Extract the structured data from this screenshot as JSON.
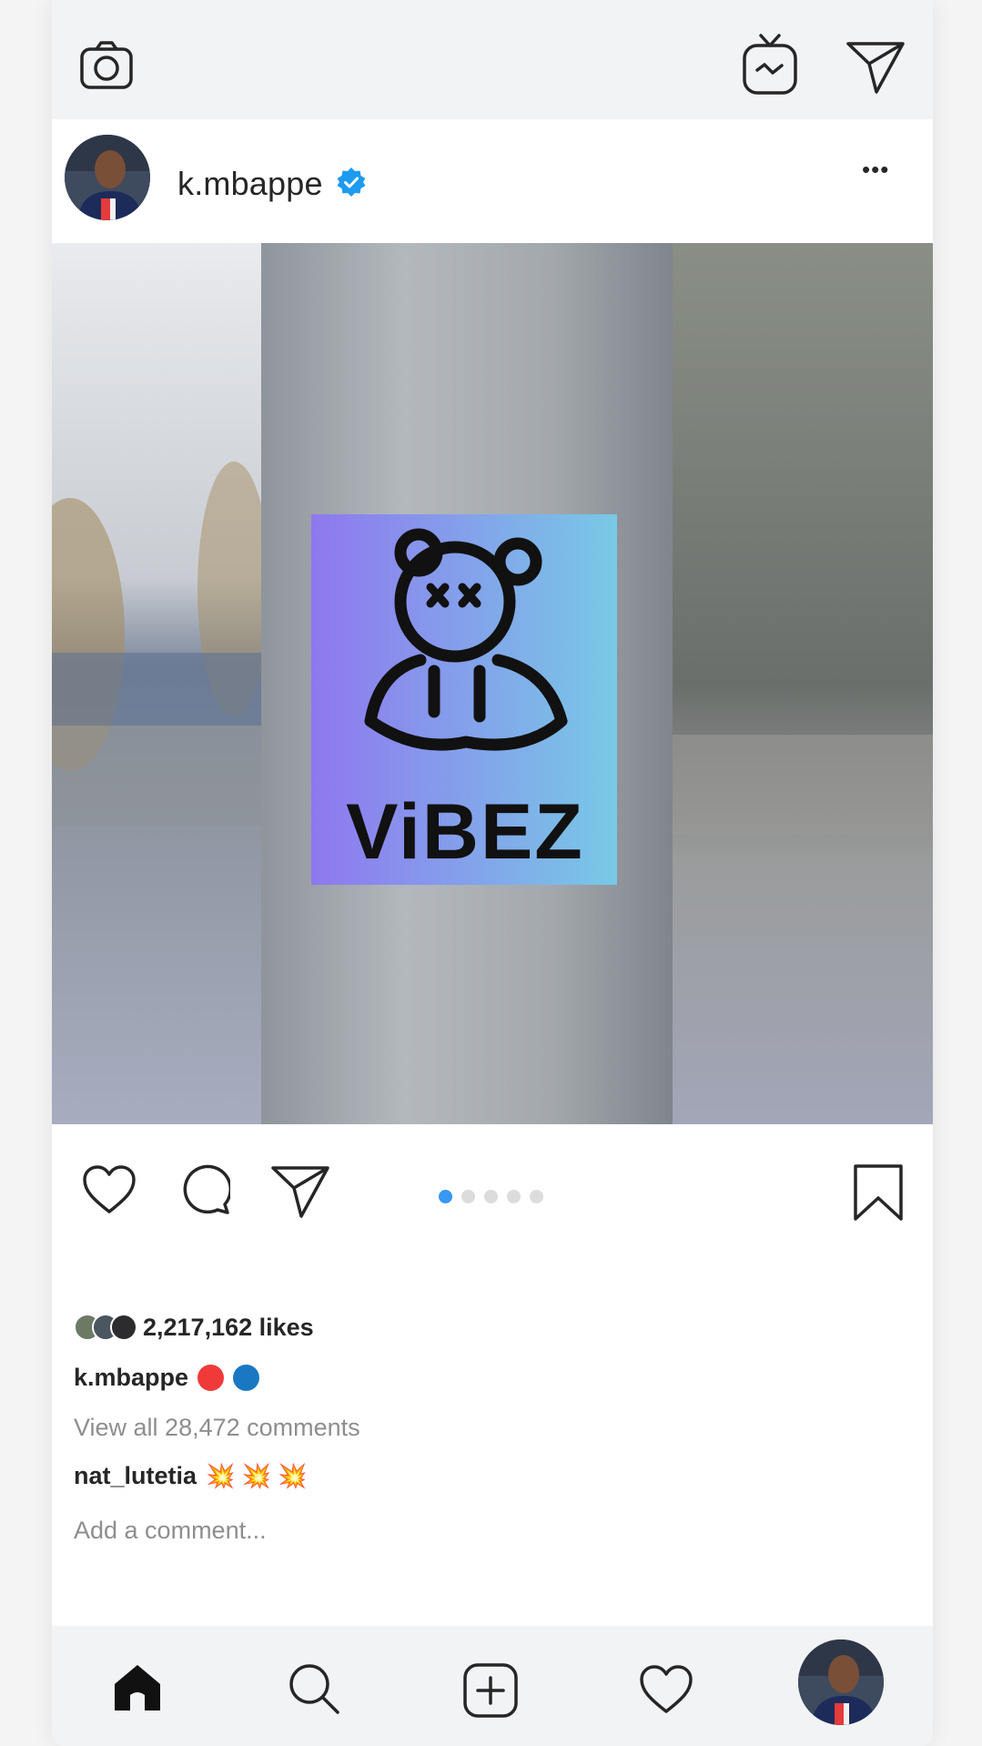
{
  "post": {
    "username": "k.mbappe",
    "more_label": "•••",
    "photo_text": "ViBEZ",
    "carousel": {
      "count": 5,
      "active_index": 0
    },
    "likes": "2,217,162 likes",
    "caption_username": "k.mbappe",
    "caption_emojis": [
      "#f03a3a",
      "#1a78c2"
    ],
    "view_comments": "View all 28,472 comments",
    "comment": {
      "username": "nat_lutetia",
      "text": "💥 💥 💥"
    },
    "add_comment_placeholder": "Add a comment..."
  },
  "colors": {
    "verified": "#1d9bf0",
    "carousel_active": "#3897f0",
    "bar_background": "#f2f3f5"
  },
  "icons": {
    "top_left": "camera-icon",
    "top_right": [
      "igtv-icon",
      "direct-message-icon"
    ],
    "post_actions": [
      "heart-icon",
      "comment-icon",
      "share-icon",
      "bookmark-icon"
    ],
    "bottom_nav": [
      "home-icon",
      "search-icon",
      "new-post-icon",
      "activity-heart-icon",
      "profile-avatar"
    ]
  }
}
